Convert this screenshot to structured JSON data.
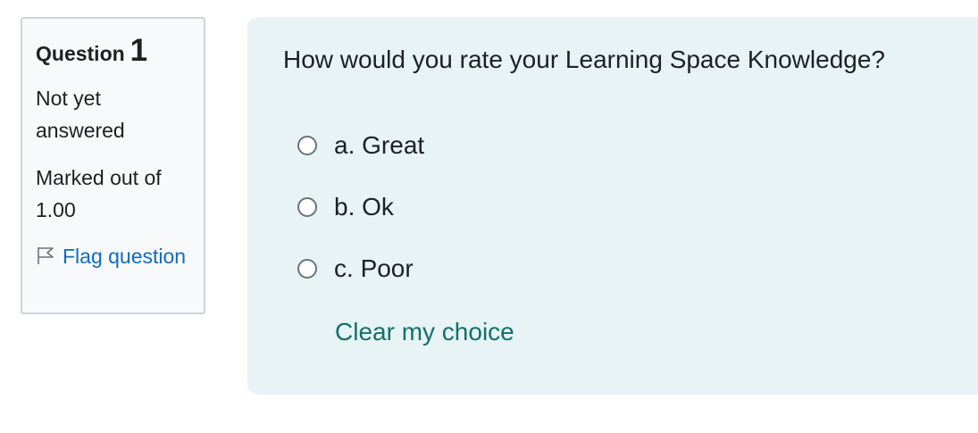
{
  "info": {
    "question_word": "Question",
    "question_number": "1",
    "state": "Not yet answered",
    "grade": "Marked out of 1.00",
    "flag_label": "Flag question"
  },
  "question": {
    "text": "How would you rate your Learning Space Knowledge?",
    "answers": [
      {
        "prefix": "a.",
        "label": "Great",
        "selected": false
      },
      {
        "prefix": "b.",
        "label": "Ok",
        "selected": false
      },
      {
        "prefix": "c.",
        "label": "Poor",
        "selected": false
      }
    ],
    "clear_label": "Clear my choice"
  },
  "colors": {
    "link": "#0f6cbf",
    "clear_link": "#15706a",
    "content_bg": "#e7f3f5",
    "info_bg": "#f8f9fa"
  },
  "icons": {
    "flag": "flag-outline-icon"
  }
}
